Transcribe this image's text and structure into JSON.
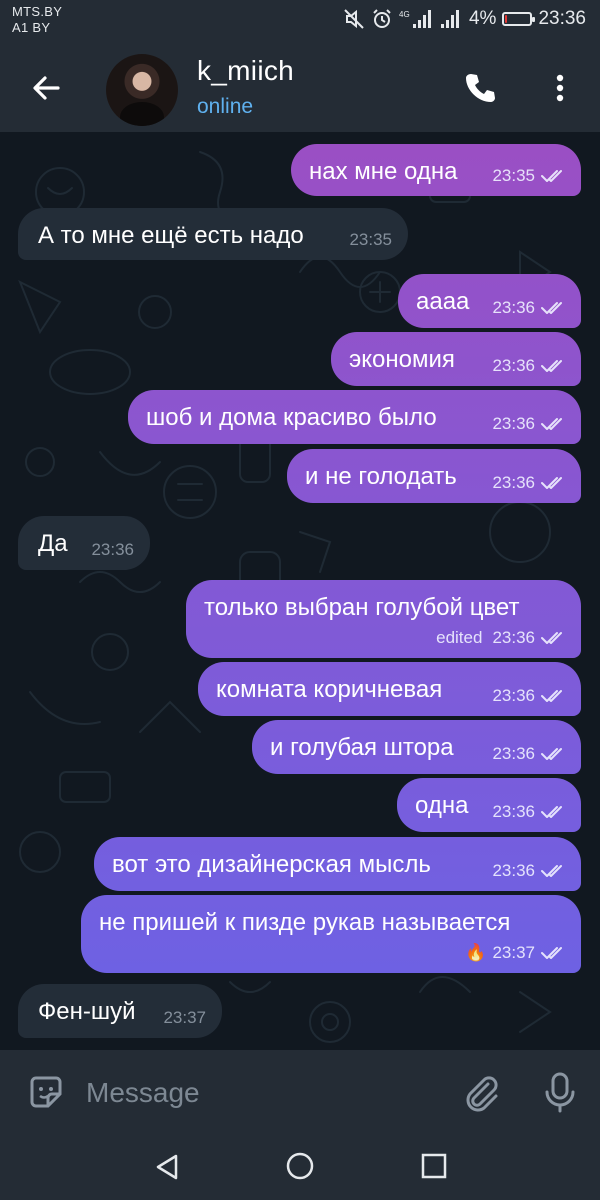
{
  "status_bar": {
    "carrier_1": "MTS.BY",
    "carrier_2": "A1 BY",
    "network": "4G",
    "battery_percent": "4%",
    "battery_level": 0.04,
    "time": "23:36"
  },
  "header": {
    "contact_name": "k_miich",
    "status": "online"
  },
  "messages": [
    {
      "direction": "out",
      "text": "нах мне одна",
      "time": "23:35",
      "read": true
    },
    {
      "direction": "in",
      "text": "А то мне ещё есть надо",
      "time": "23:35"
    },
    {
      "direction": "out",
      "text": "аааа",
      "time": "23:36",
      "read": true
    },
    {
      "direction": "out",
      "text": "экономия",
      "time": "23:36",
      "read": true
    },
    {
      "direction": "out",
      "text": "шоб и дома красиво было",
      "time": "23:36",
      "read": true
    },
    {
      "direction": "out",
      "text": "и не голодать",
      "time": "23:36",
      "read": true
    },
    {
      "direction": "in",
      "text": "Да",
      "time": "23:36"
    },
    {
      "direction": "out",
      "text": "только выбран голубой цвет",
      "edited": "edited",
      "time": "23:36",
      "read": true
    },
    {
      "direction": "out",
      "text": "комната коричневая",
      "time": "23:36",
      "read": true
    },
    {
      "direction": "out",
      "text": "и голубая штора",
      "time": "23:36",
      "read": true
    },
    {
      "direction": "out",
      "text": "одна",
      "time": "23:36",
      "read": true
    },
    {
      "direction": "out",
      "text": "вот это дизайнерская мысль",
      "time": "23:36",
      "read": true
    },
    {
      "direction": "out",
      "text": "не пришей к пизде рукав называется",
      "reaction": "🔥",
      "time": "23:37",
      "read": true
    },
    {
      "direction": "in",
      "text": "Фен-шуй",
      "time": "23:37"
    }
  ],
  "input": {
    "placeholder": "Message"
  },
  "colors": {
    "header_bg": "#242c35",
    "accent": "#5fb1ef",
    "incoming_bubble": "#232d38",
    "outgoing_gradient_top": "#9b4fc4",
    "outgoing_gradient_bottom": "#6a63e6"
  },
  "icons": {
    "back": "arrow-left-icon",
    "call": "phone-icon",
    "more": "more-vertical-icon",
    "sticker": "sticker-icon",
    "attach": "paperclip-icon",
    "mic": "microphone-icon",
    "read_receipt": "double-check-icon"
  }
}
